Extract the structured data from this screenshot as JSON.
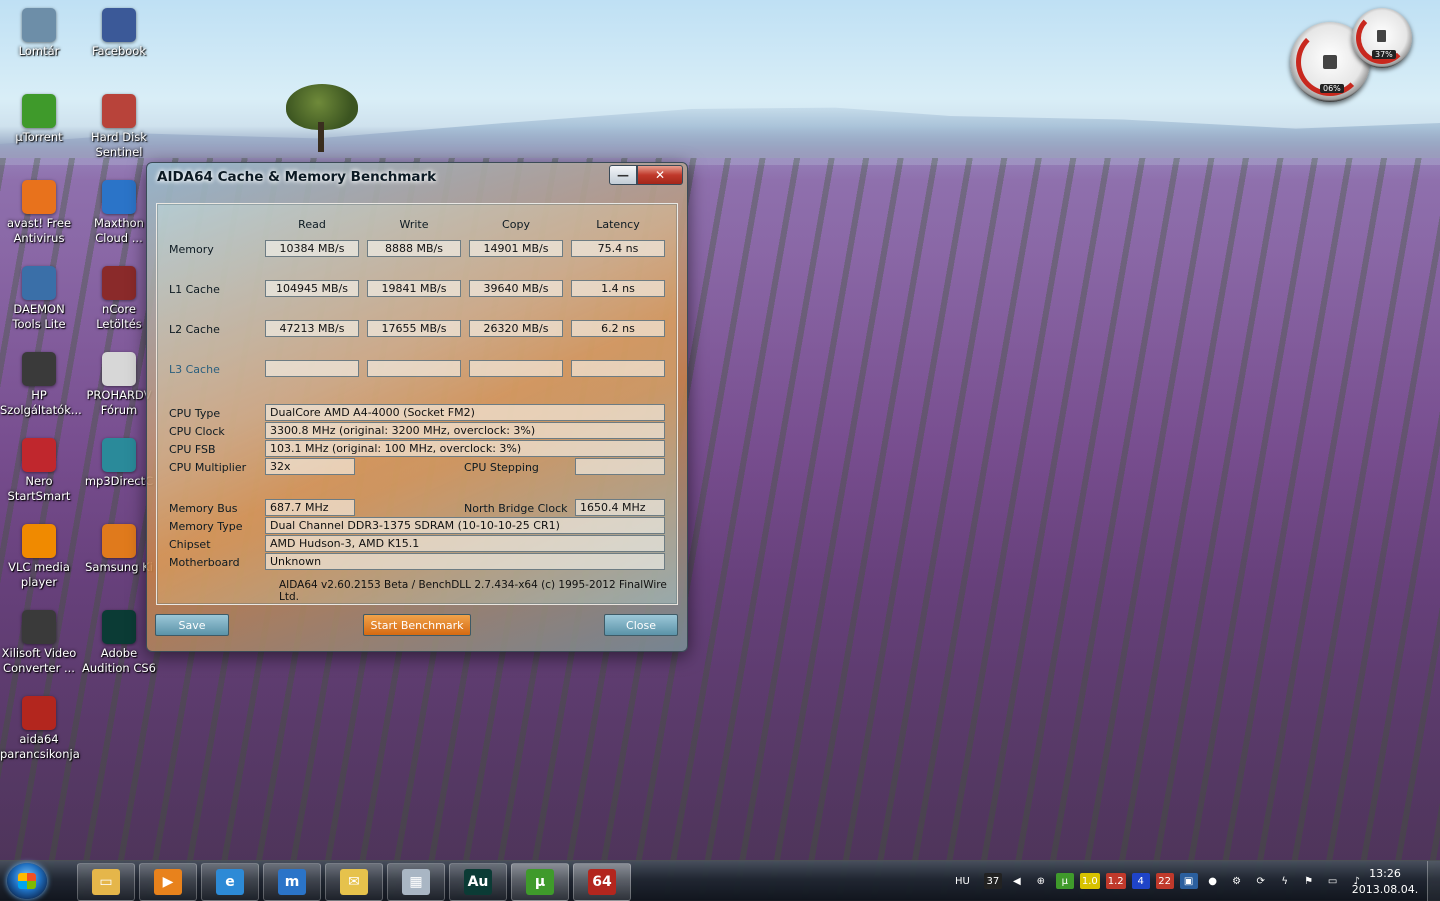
{
  "desktop": {
    "icons": [
      {
        "label": "Lomtár",
        "icon": "recycle-bin-icon",
        "color": "#6d8ea8"
      },
      {
        "label": "Facebook",
        "icon": "facebook-icon",
        "color": "#3b5998"
      },
      {
        "label": "µTorrent",
        "icon": "utorrent-icon",
        "color": "#3f9a2b"
      },
      {
        "label": "Hard Disk Sentinel",
        "icon": "hard-disk-sentinel-icon",
        "color": "#b8433a"
      },
      {
        "label": "avast! Free Antivirus",
        "icon": "avast-icon",
        "color": "#e8721c"
      },
      {
        "label": "Maxthon Cloud ...",
        "icon": "maxthon-icon",
        "color": "#2b74c8"
      },
      {
        "label": "DAEMON Tools Lite",
        "icon": "daemon-tools-icon",
        "color": "#3a6fa8"
      },
      {
        "label": "nCore Letöltés",
        "icon": "ncore-icon",
        "color": "#8a2a2a"
      },
      {
        "label": "HP Szolgáltatók...",
        "icon": "hp-icon",
        "color": "#3a3a3a"
      },
      {
        "label": "PROHARDV Fórum",
        "icon": "prohardver-icon",
        "color": "#d7d7d7"
      },
      {
        "label": "Nero StartSmart",
        "icon": "nero-icon",
        "color": "#c0272d"
      },
      {
        "label": "mp3DirectC",
        "icon": "mp3directcut-icon",
        "color": "#2a8a9a"
      },
      {
        "label": "VLC media player",
        "icon": "vlc-icon",
        "color": "#f08a00"
      },
      {
        "label": "Samsung Ki",
        "icon": "samsung-kies-icon",
        "color": "#e07a1c"
      },
      {
        "label": "Xilisoft Video Converter ...",
        "icon": "xilisoft-icon",
        "color": "#3a3a3a"
      },
      {
        "label": "Adobe Audition CS6",
        "icon": "adobe-audition-icon",
        "color": "#0b3b35"
      },
      {
        "label": "aida64 parancsikonja",
        "icon": "aida64-icon",
        "color": "#b3261e"
      }
    ],
    "gadget": {
      "cpu": "06%",
      "memory": "37%"
    }
  },
  "window": {
    "title": "AIDA64 Cache & Memory Benchmark",
    "minimize_glyph": "—",
    "close_glyph": "✕",
    "columns": [
      "Read",
      "Write",
      "Copy",
      "Latency"
    ],
    "rows": [
      {
        "label": "Memory",
        "values": [
          "10384 MB/s",
          "8888 MB/s",
          "14901 MB/s",
          "75.4 ns"
        ]
      },
      {
        "label": "L1 Cache",
        "values": [
          "104945 MB/s",
          "19841 MB/s",
          "39640 MB/s",
          "1.4 ns"
        ]
      },
      {
        "label": "L2 Cache",
        "values": [
          "47213 MB/s",
          "17655 MB/s",
          "26320 MB/s",
          "6.2 ns"
        ]
      },
      {
        "label": "L3 Cache",
        "values": [
          "",
          "",
          "",
          ""
        ]
      }
    ],
    "info": {
      "cpu_type_label": "CPU Type",
      "cpu_type": "DualCore AMD A4-4000  (Socket FM2)",
      "cpu_clock_label": "CPU Clock",
      "cpu_clock": "3300.8 MHz  (original: 3200 MHz, overclock: 3%)",
      "cpu_fsb_label": "CPU FSB",
      "cpu_fsb": "103.1 MHz  (original: 100 MHz, overclock: 3%)",
      "cpu_multiplier_label": "CPU Multiplier",
      "cpu_multiplier": "32x",
      "cpu_stepping_label": "CPU Stepping",
      "cpu_stepping": "",
      "memory_bus_label": "Memory Bus",
      "memory_bus": "687.7 MHz",
      "north_bridge_label": "North Bridge Clock",
      "north_bridge": "1650.4 MHz",
      "memory_type_label": "Memory Type",
      "memory_type": "Dual Channel DDR3-1375 SDRAM  (10-10-10-25 CR1)",
      "chipset_label": "Chipset",
      "chipset": "AMD Hudson-3, AMD K15.1",
      "motherboard_label": "Motherboard",
      "motherboard": "Unknown"
    },
    "copyright": "AIDA64 v2.60.2153 Beta / BenchDLL 2.7.434-x64  (c) 1995-2012 FinalWire Ltd.",
    "buttons": {
      "save": "Save",
      "start": "Start Benchmark",
      "close": "Close"
    }
  },
  "taskbar": {
    "apps": [
      {
        "name": "taskbar-explorer",
        "icon": "folder-icon",
        "glyph": "▭",
        "color": "#e5b64a",
        "active": false
      },
      {
        "name": "taskbar-media-player",
        "icon": "media-player-icon",
        "glyph": "▶",
        "color": "#e8821c",
        "active": false
      },
      {
        "name": "taskbar-internet-explorer",
        "icon": "internet-explorer-icon",
        "glyph": "e",
        "color": "#2d8ad6",
        "active": false
      },
      {
        "name": "taskbar-maxthon",
        "icon": "maxthon-icon",
        "glyph": "m",
        "color": "#2b74c8",
        "active": false
      },
      {
        "name": "taskbar-mail",
        "icon": "mail-icon",
        "glyph": "✉",
        "color": "#e6c24c",
        "active": false
      },
      {
        "name": "taskbar-calculator",
        "icon": "calculator-icon",
        "glyph": "▦",
        "color": "#a9b6c4",
        "active": false
      },
      {
        "name": "taskbar-audition",
        "icon": "adobe-audition-icon",
        "glyph": "Au",
        "color": "#0b3b35",
        "active": false
      },
      {
        "name": "taskbar-utorrent",
        "icon": "utorrent-icon",
        "glyph": "µ",
        "color": "#3f9a2b",
        "active": true
      },
      {
        "name": "taskbar-aida64",
        "icon": "aida64-icon",
        "glyph": "64",
        "color": "#b3261e",
        "active": true
      }
    ],
    "tray": {
      "language": "HU",
      "items": [
        {
          "label": "37",
          "bg": "#222222"
        },
        {
          "label": "◀",
          "bg": "transparent"
        },
        {
          "label": "⊕",
          "bg": "transparent"
        },
        {
          "label": "µ",
          "bg": "#3f9a2b"
        },
        {
          "label": "1.0",
          "bg": "#d8c200"
        },
        {
          "label": "1.2",
          "bg": "#c0392b"
        },
        {
          "label": "4",
          "bg": "#1f44c8"
        },
        {
          "label": "22",
          "bg": "#c0392b"
        },
        {
          "label": "▣",
          "bg": "#2b5f9e"
        },
        {
          "label": "●",
          "bg": "transparent"
        },
        {
          "label": "⚙",
          "bg": "transparent"
        },
        {
          "label": "⟳",
          "bg": "transparent"
        },
        {
          "label": "ϟ",
          "bg": "transparent"
        },
        {
          "label": "⚑",
          "bg": "transparent"
        },
        {
          "label": "▭",
          "bg": "transparent"
        },
        {
          "label": "♪",
          "bg": "transparent"
        }
      ],
      "time": "13:26",
      "date": "2013.08.04."
    }
  }
}
